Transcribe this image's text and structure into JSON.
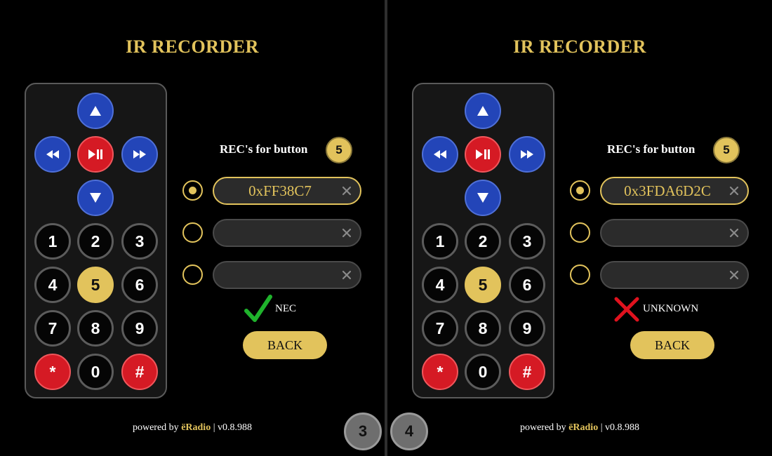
{
  "panels": [
    {
      "title": "IR RECORDER",
      "remote": {
        "buttons": [
          "1",
          "2",
          "3",
          "4",
          "5",
          "6",
          "7",
          "8",
          "9",
          "*",
          "0",
          "#"
        ],
        "selected": "5"
      },
      "rec_label": "REC's for button",
      "rec_button": "5",
      "recordings": [
        {
          "value": "0xFF38C7",
          "selected": true
        },
        {
          "value": "",
          "selected": false
        },
        {
          "value": "",
          "selected": false
        }
      ],
      "status": {
        "icon": "checkmark-icon",
        "text": "NEC",
        "color": "#1fb32c"
      },
      "back_label": "BACK",
      "footer": {
        "prefix": "powered by ",
        "brand": "ëRadio",
        "version": " | v0.8.988"
      }
    },
    {
      "title": "IR RECORDER",
      "remote": {
        "buttons": [
          "1",
          "2",
          "3",
          "4",
          "5",
          "6",
          "7",
          "8",
          "9",
          "*",
          "0",
          "#"
        ],
        "selected": "5"
      },
      "rec_label": "REC's for button",
      "rec_button": "5",
      "recordings": [
        {
          "value": "0x3FDA6D2C",
          "selected": true
        },
        {
          "value": "",
          "selected": false
        },
        {
          "value": "",
          "selected": false
        }
      ],
      "status": {
        "icon": "cross-icon",
        "text": "UNKNOWN",
        "color": "#e0121e"
      },
      "back_label": "BACK",
      "footer": {
        "prefix": "powered by ",
        "brand": "ëRadio",
        "version": " | v0.8.988"
      }
    }
  ],
  "pager": [
    "3",
    "4"
  ],
  "colors": {
    "accent": "#e2c35c",
    "blue": "#2345b8",
    "red": "#d51a24",
    "background": "#000000"
  }
}
